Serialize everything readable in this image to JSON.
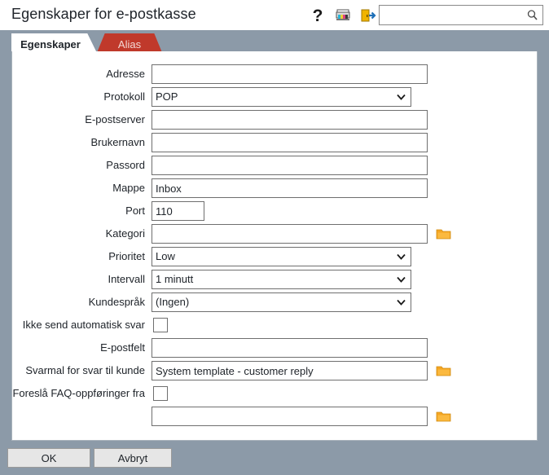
{
  "window": {
    "title": "Egenskaper for e-postkasse",
    "background_color": "#8c9aa8"
  },
  "titlebar": {
    "icons": [
      {
        "name": "help-icon",
        "glyph": "?",
        "label": "Hjelp"
      },
      {
        "name": "print-icon",
        "label": "Skriv ut"
      },
      {
        "name": "exit-icon",
        "label": "Avslutt"
      }
    ],
    "search": {
      "value": "",
      "placeholder": ""
    }
  },
  "tabs": [
    {
      "label": "Egenskaper",
      "active": true
    },
    {
      "label": "Alias",
      "active": false
    }
  ],
  "colors": {
    "tab_inactive": "#c0392b",
    "folder_icon": "#f5a623",
    "window_chrome": "#8c9aa8"
  },
  "form": {
    "rows": [
      {
        "label": "Adresse",
        "type": "text",
        "value": ""
      },
      {
        "label": "Protokoll",
        "type": "select",
        "value": "POP"
      },
      {
        "label": "E-postserver",
        "type": "text",
        "value": ""
      },
      {
        "label": "Brukernavn",
        "type": "text",
        "value": ""
      },
      {
        "label": "Passord",
        "type": "text",
        "value": ""
      },
      {
        "label": "Mappe",
        "type": "text",
        "value": "Inbox"
      },
      {
        "label": "Port",
        "type": "text-narrow",
        "value": "110"
      },
      {
        "label": "Kategori",
        "type": "text-folder",
        "value": ""
      },
      {
        "label": "Prioritet",
        "type": "select",
        "value": "Low"
      },
      {
        "label": "Intervall",
        "type": "select",
        "value": "1 minutt"
      },
      {
        "label": "Kundespråk",
        "type": "select",
        "value": "(Ingen)"
      },
      {
        "label": "Ikke send automatisk svar",
        "type": "checkbox",
        "checked": false
      },
      {
        "label": "E-postfelt",
        "type": "text",
        "value": ""
      },
      {
        "label": "Svarmal for svar til kunde",
        "type": "text-folder",
        "value": "System template - customer reply"
      },
      {
        "label": "Foreslå FAQ-oppføringer fra",
        "type": "checkbox",
        "checked": false
      },
      {
        "label": "",
        "type": "text-folder",
        "value": ""
      }
    ]
  },
  "footer": {
    "ok_label": "OK",
    "cancel_label": "Avbryt"
  }
}
